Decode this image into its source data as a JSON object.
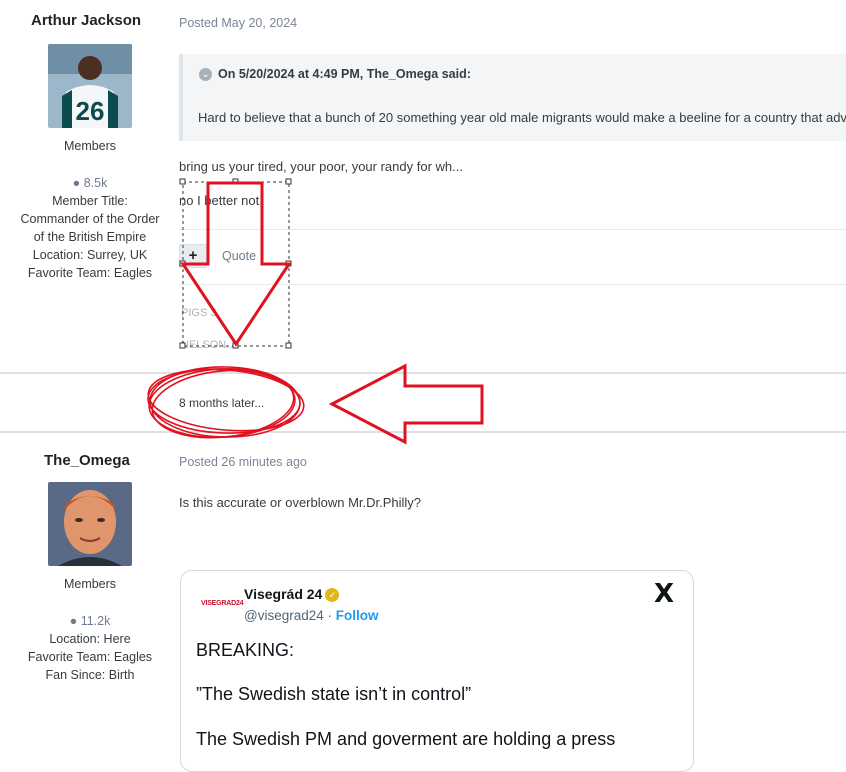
{
  "post1": {
    "author": "Arthur Jackson",
    "group": "Members",
    "post_count": "8.5k",
    "title_line1": "Member Title:",
    "title_line2": "Commander of the Order",
    "title_line3": "of the British Empire",
    "location": "Location: Surrey, UK",
    "team": "Favorite Team: Eagles",
    "posted": "Posted May 20, 2024",
    "quote_header": "On 5/20/2024 at 4:49 PM, The_Omega said:",
    "quote_text": "Hard to believe that a bunch of 20 something year old male migrants would make a beeline for a country that adv",
    "line1": "bring us your tired, your poor, your randy for wh...",
    "line2": "no I better not.",
    "plus_label": "+",
    "quote_label": "Quote",
    "sig1": "PIGS 3",
    "sig2": "NELSON..."
  },
  "separator": {
    "label": "8 months later..."
  },
  "post2": {
    "author": "The_Omega",
    "group": "Members",
    "post_count": "11.2k",
    "location": "Location: Here",
    "team": "Favorite Team: Eagles",
    "fan_since": "Fan Since: Birth",
    "posted": "Posted 26 minutes ago",
    "body": "Is this accurate or overblown Mr.Dr.Philly?",
    "tweet": {
      "logo_text": "VISEGRAD24",
      "name": "Visegrád 24",
      "handle": "@visegrad24",
      "dot": "·",
      "follow": "Follow",
      "x_icon": "X",
      "text1": "BREAKING:",
      "text2": "”The Swedish state isn’t in control”",
      "text3": "The Swedish PM and goverment are holding a press"
    }
  },
  "colors": {
    "annotation_red": "#e0121f",
    "link_gray": "#6d7b8f",
    "follow_blue": "#1d9bf0"
  }
}
